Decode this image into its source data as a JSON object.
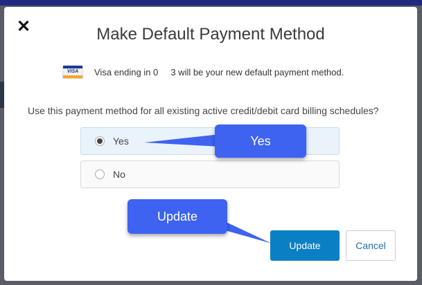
{
  "modal": {
    "close_icon": "close-icon",
    "title": "Make Default Payment Method",
    "card": {
      "brand": "VISA",
      "brand_icon": "visa-card-icon",
      "message": "Visa ending in 0     3 will be your new default payment method."
    },
    "question": "Use this payment method for all existing active credit/debit card billing schedules?",
    "options": [
      {
        "label": "Yes",
        "selected": true
      },
      {
        "label": "No",
        "selected": false
      }
    ],
    "buttons": {
      "update": "Update",
      "cancel": "Cancel"
    }
  },
  "annotations": {
    "yes": "Yes",
    "update": "Update"
  },
  "colors": {
    "primary": "#0a7fc4",
    "callout": "#3d63f0",
    "selected_bg": "#eaf3fa"
  }
}
